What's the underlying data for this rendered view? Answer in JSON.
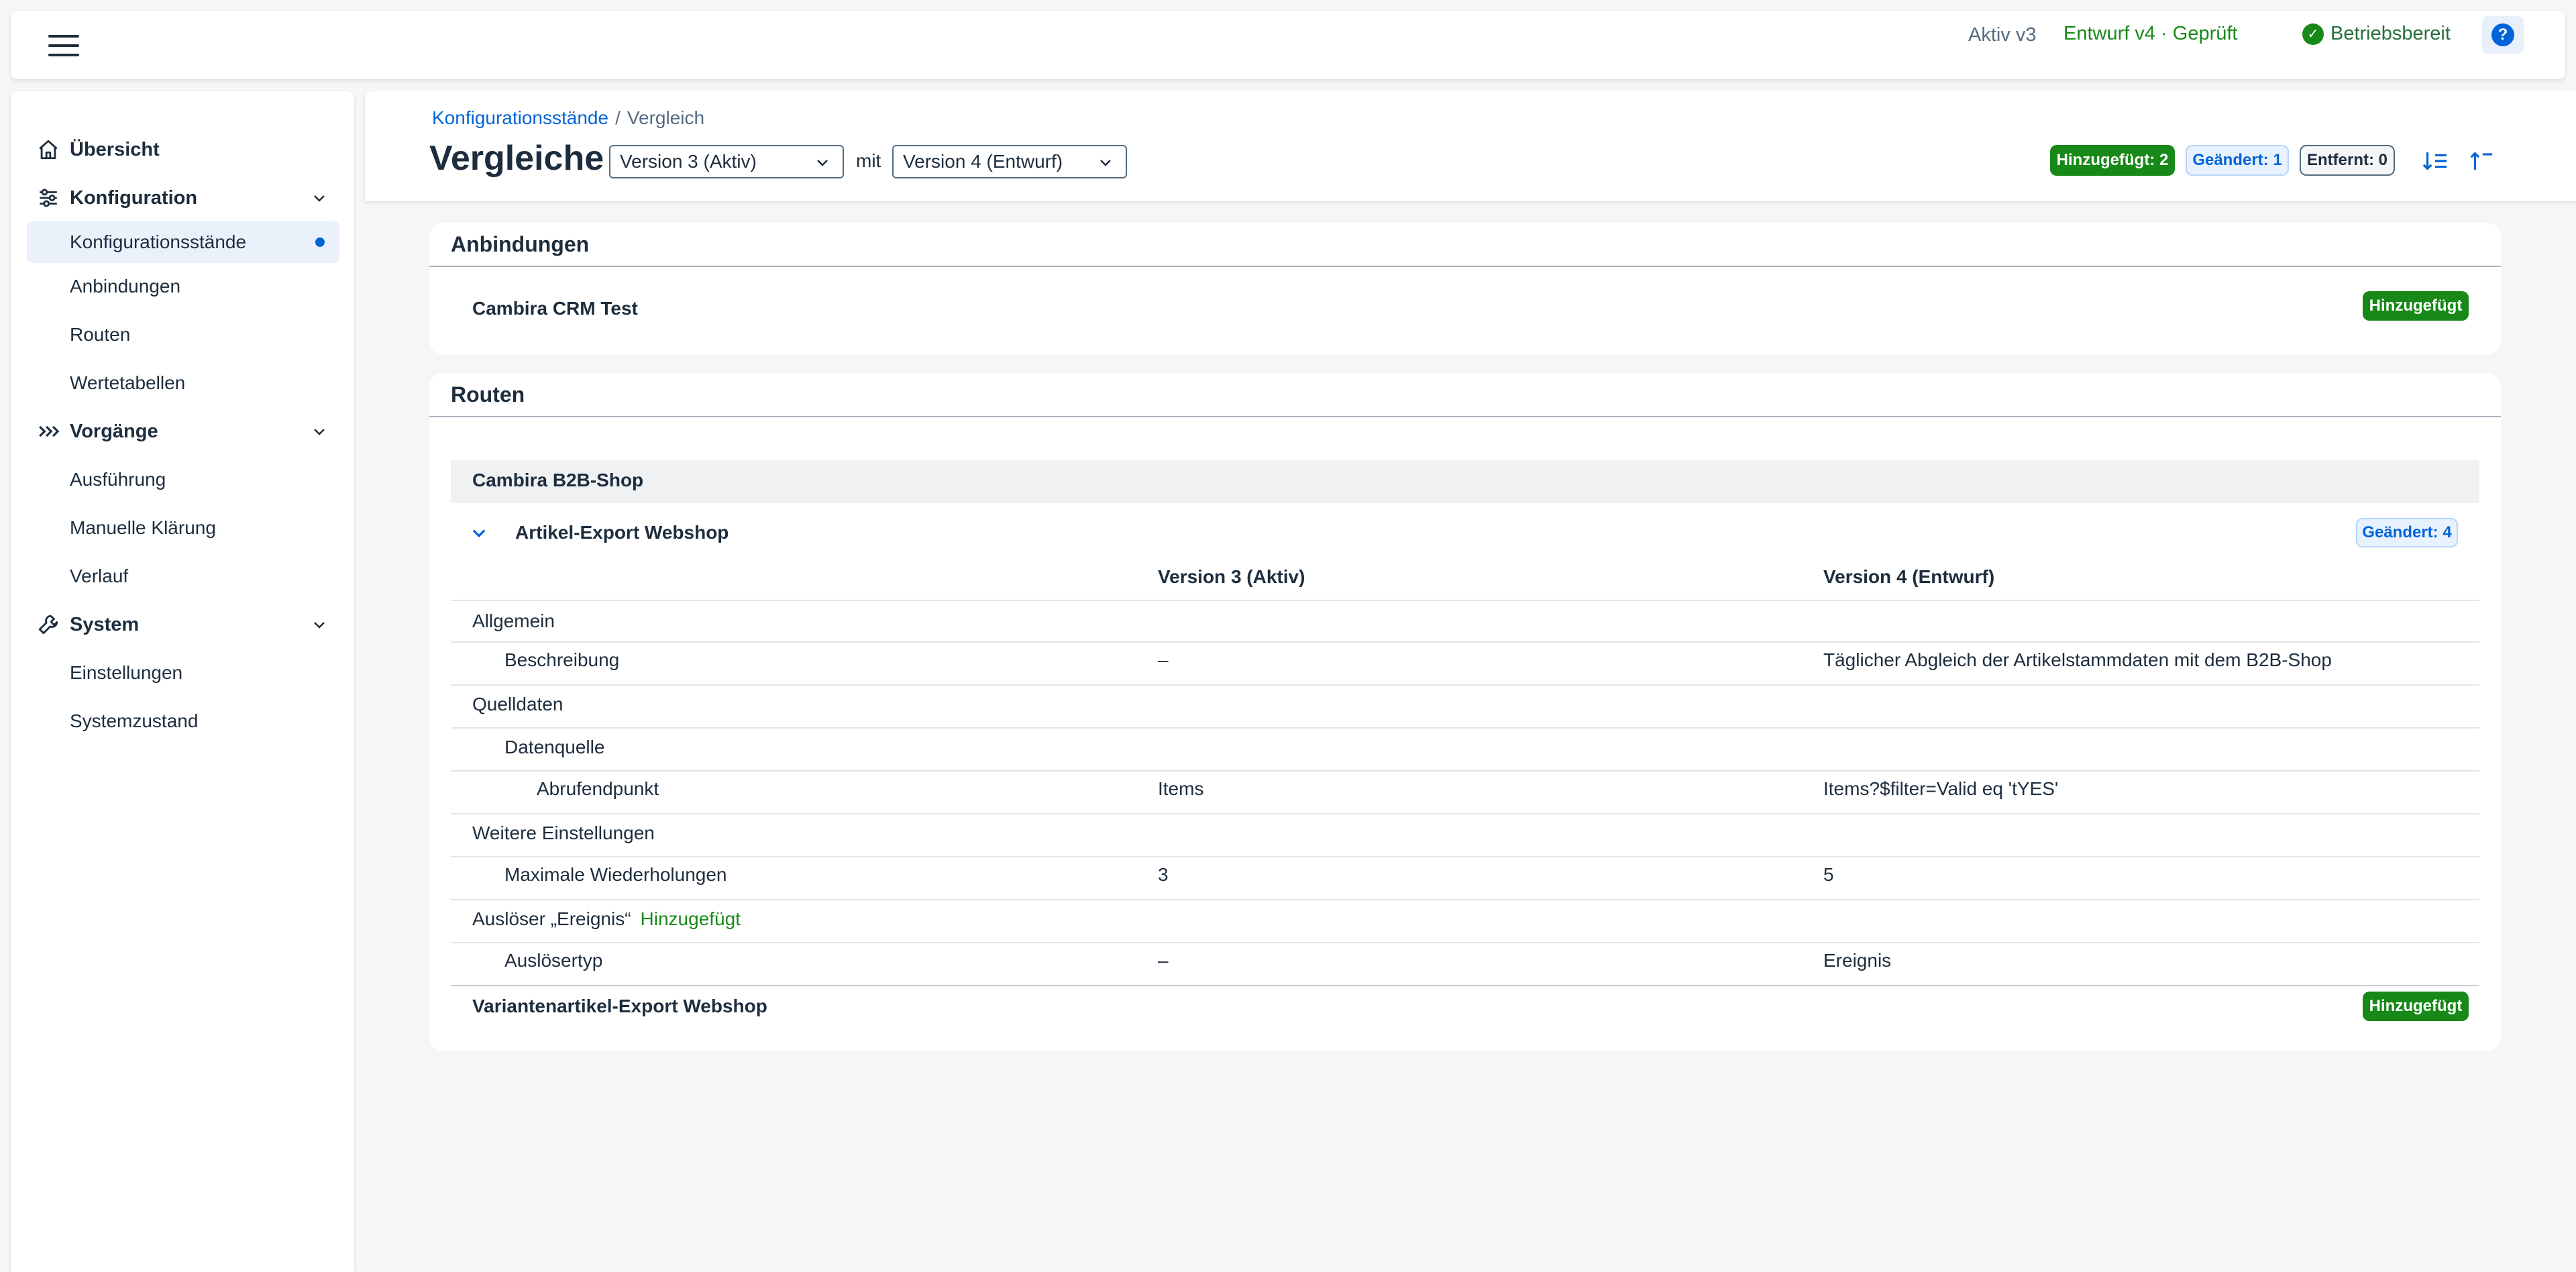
{
  "topbar": {
    "active_version": "Aktiv v3",
    "draft_version": "Entwurf v4 · Geprüft",
    "ready_status": "Betriebsbereit"
  },
  "sidebar": {
    "items": [
      {
        "label": "Übersicht"
      },
      {
        "label": "Konfiguration"
      },
      {
        "label": "Konfigurationsstände"
      },
      {
        "label": "Anbindungen"
      },
      {
        "label": "Routen"
      },
      {
        "label": "Wertetabellen"
      },
      {
        "label": "Vorgänge"
      },
      {
        "label": "Ausführung"
      },
      {
        "label": "Manuelle Klärung"
      },
      {
        "label": "Verlauf"
      },
      {
        "label": "System"
      },
      {
        "label": "Einstellungen"
      },
      {
        "label": "Systemzustand"
      }
    ]
  },
  "header": {
    "breadcrumb_parent": "Konfigurationsstände",
    "breadcrumb_sep": "/",
    "breadcrumb_current": "Vergleich",
    "title": "Vergleiche",
    "select_from": "Version 3 (Aktiv)",
    "mit": "mit",
    "select_to": "Version 4 (Entwurf)",
    "badge_added": "Hinzugefügt: 2",
    "badge_changed": "Geändert: 1",
    "badge_removed": "Entfernt: 0"
  },
  "anbindungen": {
    "title": "Anbindungen",
    "item_name": "Cambira CRM Test",
    "item_badge": "Hinzugefügt"
  },
  "routen": {
    "title": "Routen",
    "group_name": "Cambira B2B-Shop",
    "route_name": "Artikel-Export Webshop",
    "route_badge": "Geändert: 4",
    "col_v3": "Version 3 (Aktiv)",
    "col_v4": "Version 4 (Entwurf)",
    "rows": [
      {
        "label": "Allgemein",
        "v3": "",
        "v4": ""
      },
      {
        "label": "Beschreibung",
        "v3": "–",
        "v4": "Täglicher Abgleich der Artikelstammdaten mit dem B2B-Shop"
      },
      {
        "label": "Quelldaten",
        "v3": "",
        "v4": ""
      },
      {
        "label": "Datenquelle",
        "v3": "",
        "v4": ""
      },
      {
        "label": "Abrufendpunkt",
        "v3": "Items",
        "v4": "Items?$filter=Valid eq 'tYES'"
      },
      {
        "label": "Weitere Einstellungen",
        "v3": "",
        "v4": ""
      },
      {
        "label": "Maximale Wiederholungen",
        "v3": "3",
        "v4": "5"
      },
      {
        "label": "Auslöser „Ereignis“",
        "added": "Hinzugefügt",
        "v3": "",
        "v4": ""
      },
      {
        "label": "Auslösertyp",
        "v3": "–",
        "v4": "Ereignis"
      }
    ],
    "second_route_name": "Variantenartikel-Export Webshop",
    "second_route_badge": "Hinzugefügt"
  },
  "colors": {
    "accent_blue": "#0064d9",
    "positive_green": "#188918",
    "text_dark": "#1d2d3e"
  }
}
